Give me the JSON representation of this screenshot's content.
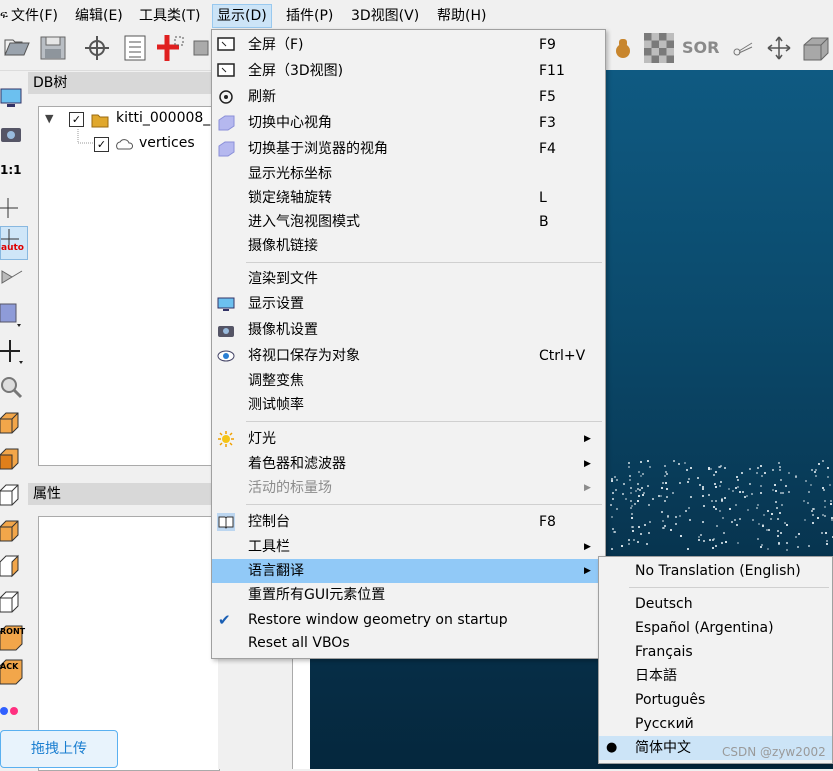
{
  "menubar": {
    "app_icon": "cloudcompare-logo-partial",
    "items": [
      "文件(F)",
      "编辑(E)",
      "工具类(T)",
      "显示(D)",
      "插件(P)",
      "3D视图(V)",
      "帮助(H)"
    ],
    "active_index": 3
  },
  "toolbar": {
    "icons": [
      "open-folder-icon",
      "save-icon",
      "point-picking-icon",
      "list-icon",
      "cross-section-icon",
      "tool-icon",
      "hand-icon",
      "checkerboard-icon",
      "sor-filter-icon",
      "scissors-icon",
      "translate-icon",
      "box-icon"
    ],
    "sor_label": "SOR"
  },
  "left_tools": {
    "icons": [
      "display-icon",
      "camera-icon",
      "scale-icon",
      "crosshair-icon",
      "auto-pivot-icon",
      "perspective-icon",
      "view-box-icon",
      "move-icon",
      "zoom-icon",
      "top-view-icon",
      "front-view-icon",
      "left-view-icon",
      "back-view-icon",
      "right-view-icon",
      "bottom-view-icon",
      "front-iso-icon",
      "back-iso-icon",
      "color-icon"
    ],
    "scale_label": "1:1",
    "auto_label": "auto",
    "front_label": "RONT",
    "back_label": "ACK"
  },
  "db_tree": {
    "title": "DB树",
    "root_label": "kitti_000008_",
    "child_label": "vertices"
  },
  "properties": {
    "title": "属性"
  },
  "menu": {
    "items": [
      {
        "label": "全屏（F)",
        "shortcut": "F9",
        "icon": "fullscreen-icon"
      },
      {
        "label": "全屏（3D视图)",
        "shortcut": "F11",
        "icon": "fullscreen-3d-icon"
      },
      {
        "label": "刷新",
        "shortcut": "F5",
        "icon": "refresh-icon"
      },
      {
        "label": "切换中心视角",
        "shortcut": "F3",
        "icon": "center-view-icon"
      },
      {
        "label": "切换基于浏览器的视角",
        "shortcut": "F4",
        "icon": "viewer-view-icon"
      },
      {
        "label": "显示光标坐标",
        "shortcut": ""
      },
      {
        "label": "锁定绕轴旋转",
        "shortcut": "L"
      },
      {
        "label": "进入气泡视图模式",
        "shortcut": "B"
      },
      {
        "label": "摄像机链接",
        "shortcut": ""
      },
      {
        "label": "渲染到文件",
        "shortcut": ""
      },
      {
        "label": "显示设置",
        "shortcut": "",
        "icon": "display-settings-icon"
      },
      {
        "label": "摄像机设置",
        "shortcut": "",
        "icon": "camera-settings-icon"
      },
      {
        "label": "将视口保存为对象",
        "shortcut": "Ctrl+V",
        "icon": "eye-icon"
      },
      {
        "label": "调整变焦",
        "shortcut": ""
      },
      {
        "label": "测试帧率",
        "shortcut": ""
      },
      {
        "label": "灯光",
        "shortcut": "",
        "icon": "sun-icon",
        "submenu": true
      },
      {
        "label": "着色器和滤波器",
        "shortcut": "",
        "submenu": true
      },
      {
        "label": "活动的标量场",
        "shortcut": "",
        "submenu": true,
        "disabled": true
      },
      {
        "label": "控制台",
        "shortcut": "F8",
        "icon": "book-icon"
      },
      {
        "label": "工具栏",
        "shortcut": "",
        "submenu": true
      },
      {
        "label": "语言翻译",
        "shortcut": "",
        "submenu": true,
        "highlighted": true
      },
      {
        "label": "重置所有GUI元素位置",
        "shortcut": ""
      },
      {
        "label": "Restore window geometry on startup",
        "shortcut": "",
        "checked": true
      },
      {
        "label": "Reset all VBOs",
        "shortcut": ""
      }
    ]
  },
  "submenu": {
    "items": [
      {
        "label": "No Translation (English)"
      },
      {
        "label": "Deutsch"
      },
      {
        "label": "Español (Argentina)"
      },
      {
        "label": "Français"
      },
      {
        "label": "日本語"
      },
      {
        "label": "Português"
      },
      {
        "label": "Русский"
      },
      {
        "label": "简体中文",
        "selected": true
      }
    ]
  },
  "upload_button": "拖拽上传",
  "watermark": "CSDN @zyw2002",
  "colors": {
    "highlight": "#91c9f7",
    "viewport": "#0b4a6c",
    "accent": "#1a7ed0"
  }
}
